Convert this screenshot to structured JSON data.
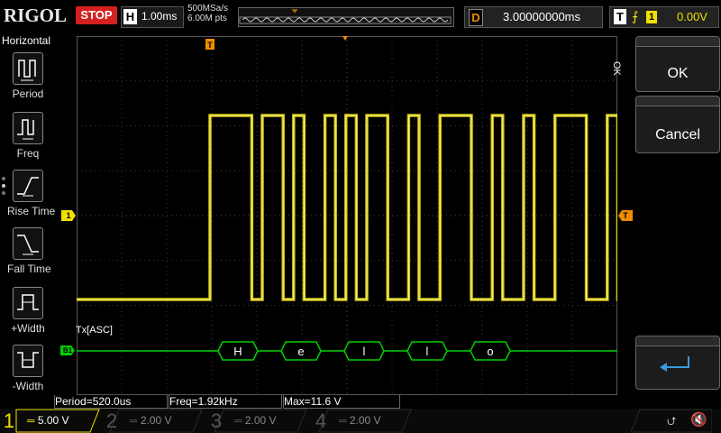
{
  "topbar": {
    "brand": "RIGOL",
    "run_state": "STOP",
    "horizontal": {
      "tag": "H",
      "timebase": "1.00ms"
    },
    "acquisition": {
      "sample_rate": "500MSa/s",
      "memory_depth": "6.00M pts"
    },
    "delay": {
      "tag": "D",
      "value": "3.00000000ms"
    },
    "trigger": {
      "tag": "T",
      "edge_icon": "rising-edge-icon",
      "source": "1",
      "level": "0.00V"
    }
  },
  "left_menu": {
    "title": "Horizontal",
    "items": [
      {
        "label": "Period",
        "icon": "period-icon"
      },
      {
        "label": "Freq",
        "icon": "frequency-icon"
      },
      {
        "label": "Rise Time",
        "icon": "rise-time-icon"
      },
      {
        "label": "Fall Time",
        "icon": "fall-time-icon"
      },
      {
        "label": "+Width",
        "icon": "positive-width-icon"
      },
      {
        "label": "-Width",
        "icon": "negative-width-icon"
      }
    ]
  },
  "right_menu": {
    "side_label": "OK",
    "ok_label": "OK",
    "cancel_label": "Cancel",
    "enter_icon": "enter-icon"
  },
  "waveform": {
    "channel1_marker": "1",
    "trigger_marker": "T",
    "decode_label": "Tx[ASC]",
    "bus_marker": "B1",
    "decoded_chars": [
      "H",
      "e",
      "l",
      "l",
      "o"
    ],
    "channel1_color": "#f0e000",
    "bus_color": "#00d000"
  },
  "measurements": {
    "period": "Period=520.0us",
    "freq": "Freq=1.92kHz",
    "max": "Max=11.6 V"
  },
  "bottom_bar": {
    "channels": [
      {
        "num": "1",
        "scale": "5.00 V",
        "color": "#f0e000",
        "active": true
      },
      {
        "num": "2",
        "scale": "2.00 V",
        "color": "#00b0b0",
        "active": false
      },
      {
        "num": "3",
        "scale": "2.00 V",
        "color": "#c040c0",
        "active": false
      },
      {
        "num": "4",
        "scale": "2.00 V",
        "color": "#3070e0",
        "active": false
      }
    ],
    "usb_icon": "usb-icon",
    "sound_icon": "speaker-muted-icon"
  }
}
